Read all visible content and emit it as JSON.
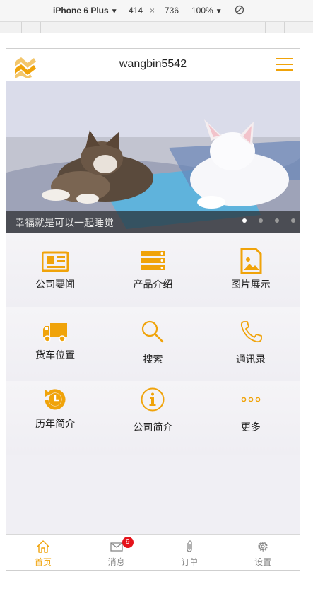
{
  "devtools": {
    "device": "iPhone 6 Plus",
    "width": "414",
    "times": "×",
    "height": "736",
    "zoom": "100%"
  },
  "header": {
    "title": "wangbin5542"
  },
  "banner": {
    "caption": "幸福就是可以一起睡觉",
    "dot_count": 4,
    "active_dot": 1
  },
  "grid": {
    "items": [
      {
        "label": "公司要闻",
        "icon": "newspaper-icon"
      },
      {
        "label": "产品介绍",
        "icon": "server-list-icon"
      },
      {
        "label": "图片展示",
        "icon": "image-file-icon"
      },
      {
        "label": "货车位置",
        "icon": "truck-icon"
      },
      {
        "label": "搜索",
        "icon": "search-icon"
      },
      {
        "label": "通讯录",
        "icon": "phone-icon"
      },
      {
        "label": "历年简介",
        "icon": "history-icon"
      },
      {
        "label": "公司简介",
        "icon": "info-icon"
      },
      {
        "label": "更多",
        "icon": "more-icon"
      }
    ]
  },
  "tabs": [
    {
      "label": "首页",
      "icon": "home-icon",
      "active": true
    },
    {
      "label": "消息",
      "icon": "mail-icon",
      "badge": "9"
    },
    {
      "label": "订单",
      "icon": "paperclip-icon"
    },
    {
      "label": "设置",
      "icon": "gear-icon"
    }
  ],
  "colors": {
    "accent": "#f0a30a",
    "badge": "#e5131b"
  }
}
